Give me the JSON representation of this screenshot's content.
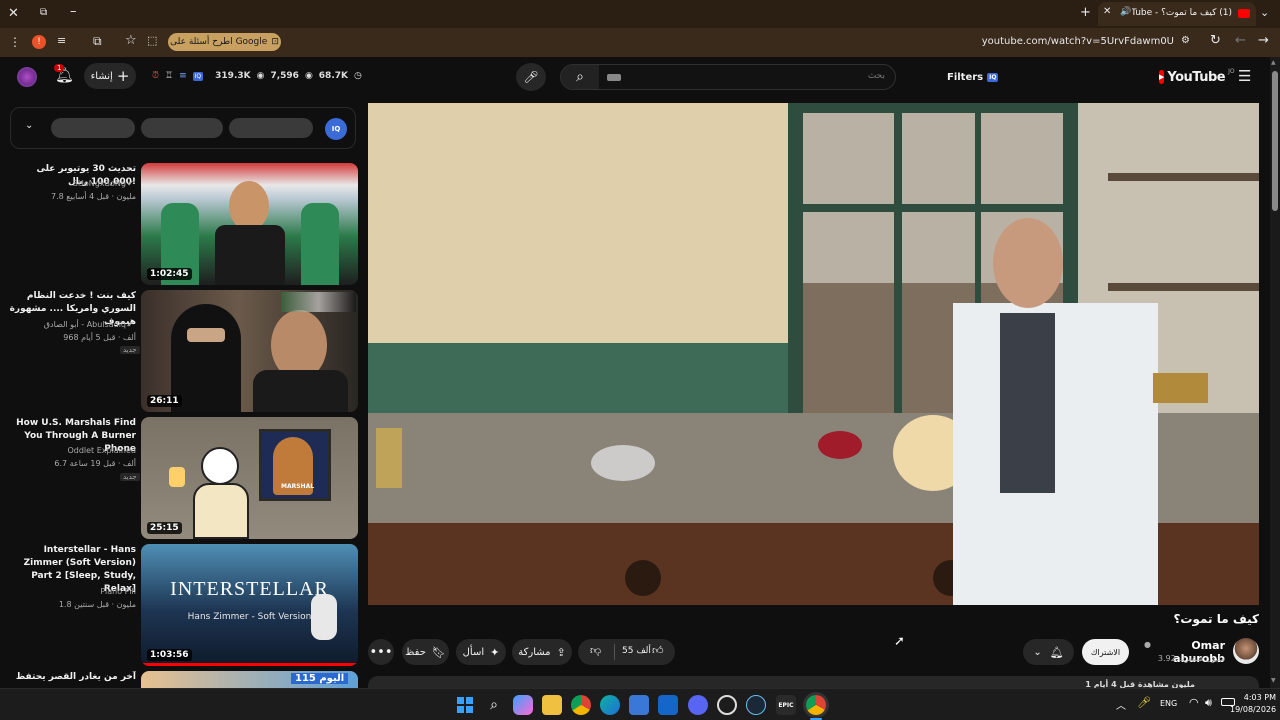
{
  "browser": {
    "tab_title": "(1) كيف ما تموت؟ - YouTube",
    "url": "youtube.com/watch?v=5UrvFdawm0U",
    "google_ask": "اطرح أسئلة على Google",
    "profile_letter": "!"
  },
  "masthead": {
    "logo_text": "YouTube",
    "logo_region": "JO",
    "filters_label": "Filters",
    "search_placeholder": "بحث",
    "create_label": "إنشاء",
    "notif_count": "1",
    "stat_views": "319.3K",
    "stat_likes": "7,596",
    "stat_subs": "68.7K"
  },
  "video": {
    "title": "كيف ما تموت؟",
    "channel": "Omar aburobb",
    "subs": "3.92 مليون مشترك",
    "subscribe_label": "الاشتراك",
    "likes": "55 ألف",
    "share_label": "مشاركة",
    "ask_label": "اسأل",
    "save_label": "حفظ",
    "desc_preview": "1 مليون مشاهدة قبل 4 أيام"
  },
  "sidebar": {
    "items": [
      {
        "title": "تحديث 30 يوتيوبر على 100,000 ريال!",
        "channel": "SHoNgxBoNg",
        "meta": "7.8 مليون · قبل 4 أسابيع",
        "duration": "1:02:45",
        "new": ""
      },
      {
        "title": "كيف بنت ! خدعت النظام السوري وامريكا .... مشهورة هيموف",
        "channel": "أبو الصادق - Abulsadiq",
        "meta": "968 ألف · قبل 5 أيام",
        "duration": "26:11",
        "new": "جديد"
      },
      {
        "title": "How U.S. Marshals Find You Through A Burner Phone",
        "channel": "Oddlet Explained",
        "meta": "6.7 ألف · قبل 19 ساعة",
        "duration": "25:15",
        "new": "جديد"
      },
      {
        "title": "Interstellar - Hans Zimmer (Soft Version) Part 2 [Sleep, Study, Relax]",
        "channel": "Piano Pill",
        "meta": "1.8 مليون · قبل سنتين",
        "duration": "1:03:56",
        "new": ""
      },
      {
        "title": "آخر من يغادر القصر يحتفظ به",
        "channel": "",
        "meta": "",
        "duration": "",
        "new": ""
      }
    ],
    "thumb3_text": "MARSHAL",
    "thumb4_text": "INTERSTELLAR",
    "thumb4_sub": "Hans Zimmer - Soft Version",
    "thumb5_text": "اليوم 115"
  },
  "taskbar": {
    "lang": "ENG",
    "time": "4:03 PM",
    "date": "19/08/2026"
  },
  "colors": {
    "accent": "#ff0000",
    "brand_blue": "#3ea6ff"
  }
}
